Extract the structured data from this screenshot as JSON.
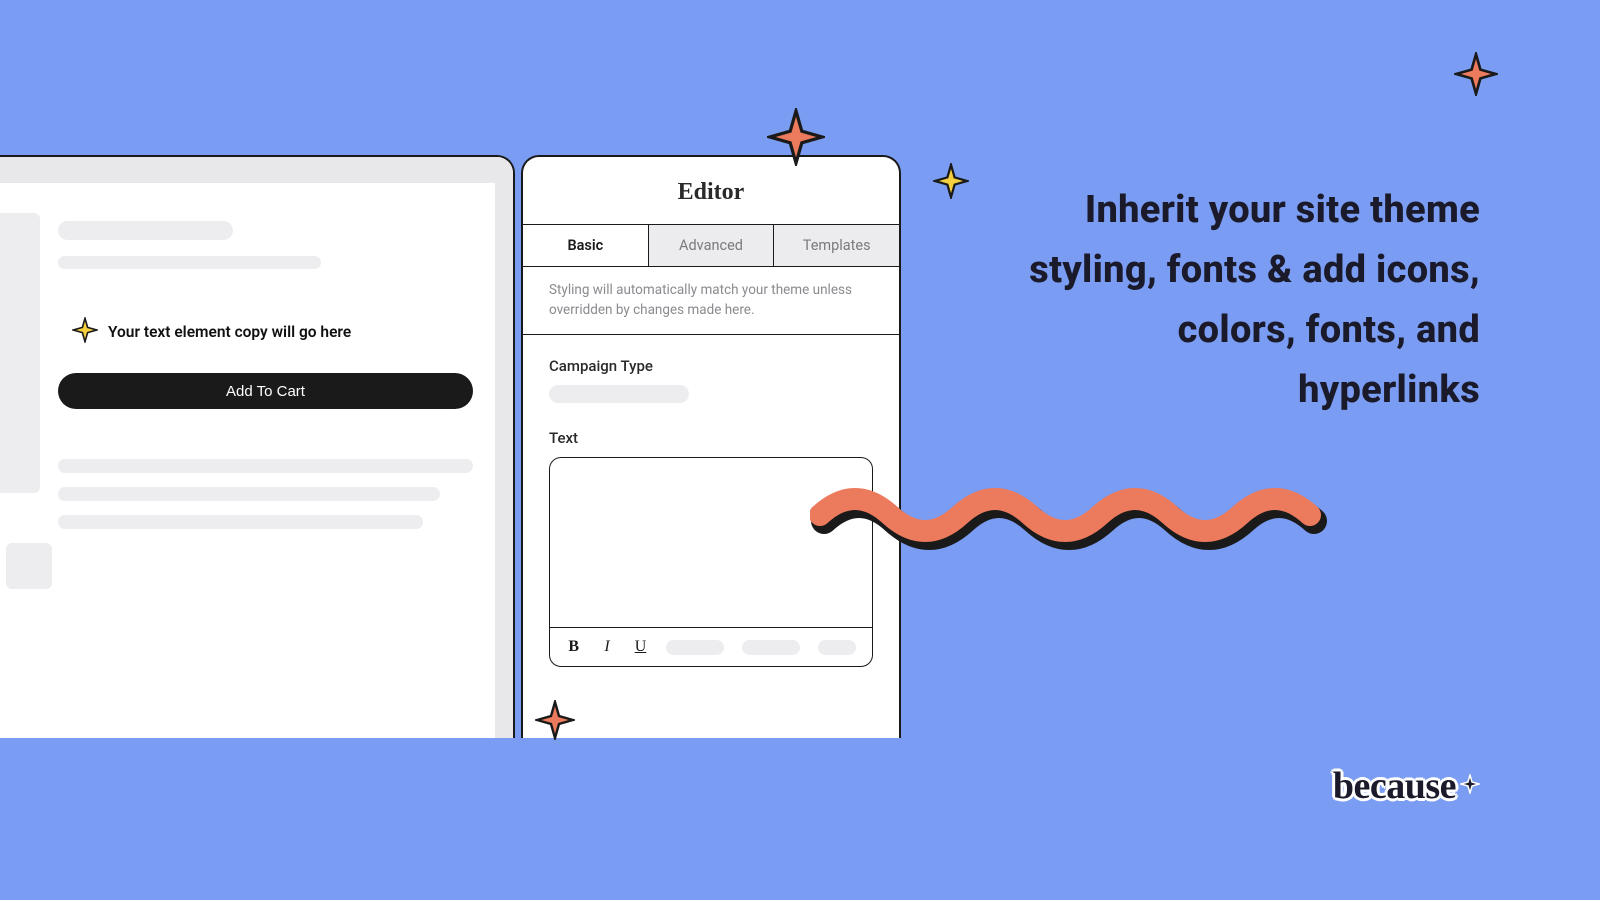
{
  "preview": {
    "text_element_label": "Your text element copy will go here",
    "add_to_cart_label": "Add To Cart"
  },
  "editor": {
    "title": "Editor",
    "tabs": {
      "basic": "Basic",
      "advanced": "Advanced",
      "templates": "Templates"
    },
    "helper_text": "Styling will automatically match your theme unless overridden by changes made here.",
    "campaign_type_label": "Campaign Type",
    "text_label": "Text",
    "format": {
      "bold": "B",
      "italic": "I",
      "underline": "U"
    }
  },
  "headline": "Inherit your site theme styling, fonts & add icons, colors, fonts, and hyperlinks",
  "brand": "because"
}
